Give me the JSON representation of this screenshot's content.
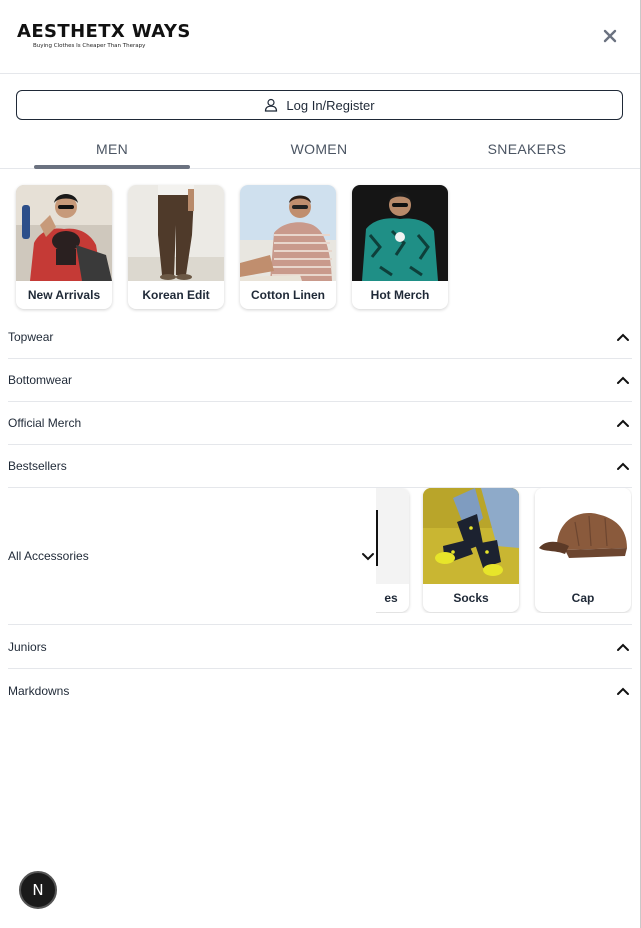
{
  "brand": {
    "name": "AESTHETX WAYS",
    "tagline": "Buying Clothes Is Cheaper Than Therapy"
  },
  "header": {
    "close_icon": "close-icon"
  },
  "login": {
    "label": "Log In/Register",
    "icon": "user-icon"
  },
  "tabs": [
    {
      "label": "MEN",
      "active": true
    },
    {
      "label": "WOMEN",
      "active": false
    },
    {
      "label": "SNEAKERS",
      "active": false
    }
  ],
  "featured": [
    {
      "label": "New Arrivals"
    },
    {
      "label": "Korean Edit"
    },
    {
      "label": "Cotton Linen"
    },
    {
      "label": "Hot Merch"
    }
  ],
  "menu_top": [
    {
      "label": "Topwear"
    },
    {
      "label": "Bottomwear"
    },
    {
      "label": "Official Merch"
    },
    {
      "label": "Bestsellers"
    }
  ],
  "accessories": {
    "label": "All Accessories",
    "items": [
      {
        "label": "es"
      },
      {
        "label": "Socks"
      },
      {
        "label": "Cap"
      }
    ]
  },
  "menu_bottom": [
    {
      "label": "Juniors"
    },
    {
      "label": "Markdowns"
    }
  ],
  "badge": {
    "label": "N"
  }
}
